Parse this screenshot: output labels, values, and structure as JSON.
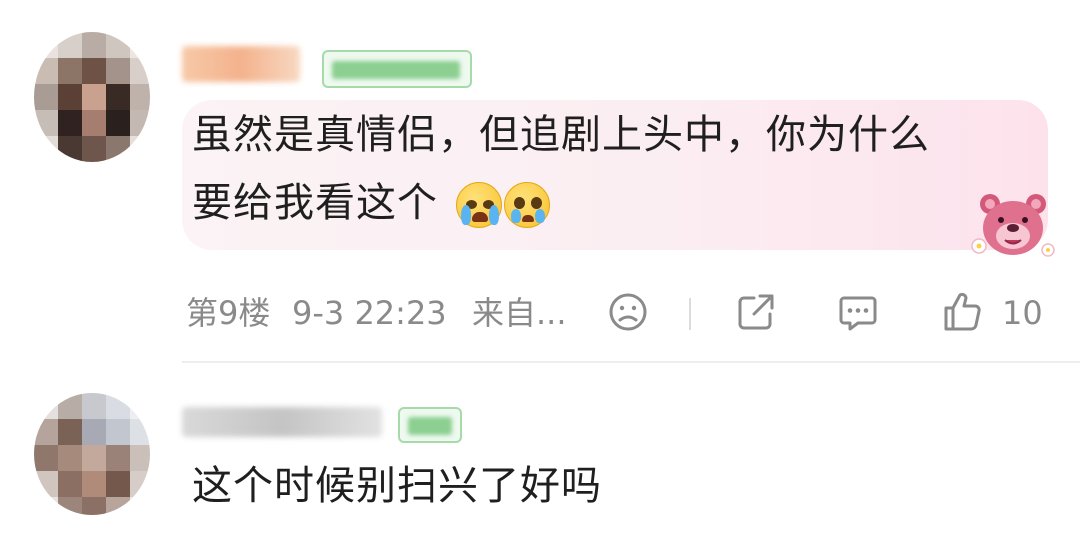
{
  "comments": [
    {
      "text_line1": "虽然是真情侣，但追剧上头中，你为什么",
      "text_line2": "要给我看这个",
      "emojis": [
        "crying-face-icon",
        "tearful-face-icon"
      ],
      "floor": "第9楼",
      "time": "9-3 22:23",
      "source": "来自...",
      "actions": [
        "dislike-icon",
        "share-icon",
        "reply-icon",
        "like-icon"
      ],
      "like_count": "10"
    },
    {
      "text": "这个时候别扫兴了好吗"
    }
  ],
  "colors": {
    "bubble": "#fbeef2",
    "badge_border": "#a6dba9",
    "meta_text": "#8a8a8a",
    "text": "#1f1f1f"
  }
}
